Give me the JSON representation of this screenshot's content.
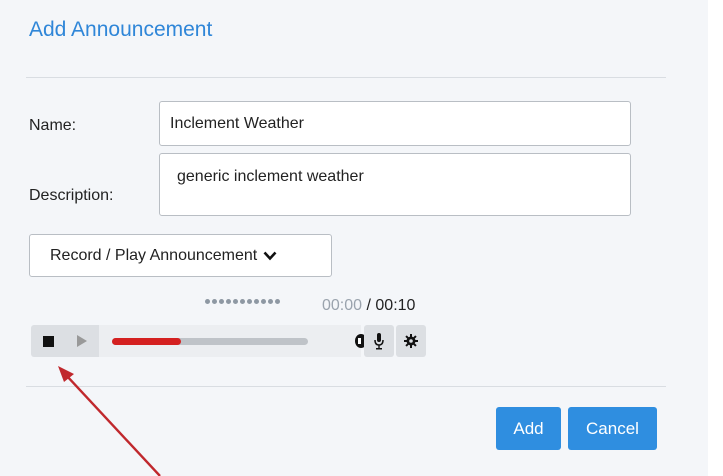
{
  "dialog": {
    "title": "Add Announcement"
  },
  "form": {
    "name_label": "Name:",
    "name_value": "Inclement Weather",
    "description_label": "Description:",
    "description_value": "generic inclement weather"
  },
  "record_dropdown": {
    "label": "Record / Play Announcement",
    "icon": "chevron-down-icon"
  },
  "player": {
    "current_time": "00:00",
    "separator": " / ",
    "total_time": "00:10",
    "progress": 0.35,
    "icons": [
      "stop-icon",
      "play-icon",
      "volume-icon",
      "microphone-icon",
      "gear-icon"
    ]
  },
  "actions": {
    "add_label": "Add",
    "cancel_label": "Cancel"
  },
  "colors": {
    "accent": "#2f86d8",
    "button_primary": "#2f8ee0",
    "progress": "#d42020",
    "annotation_arrow": "#c0282d"
  }
}
